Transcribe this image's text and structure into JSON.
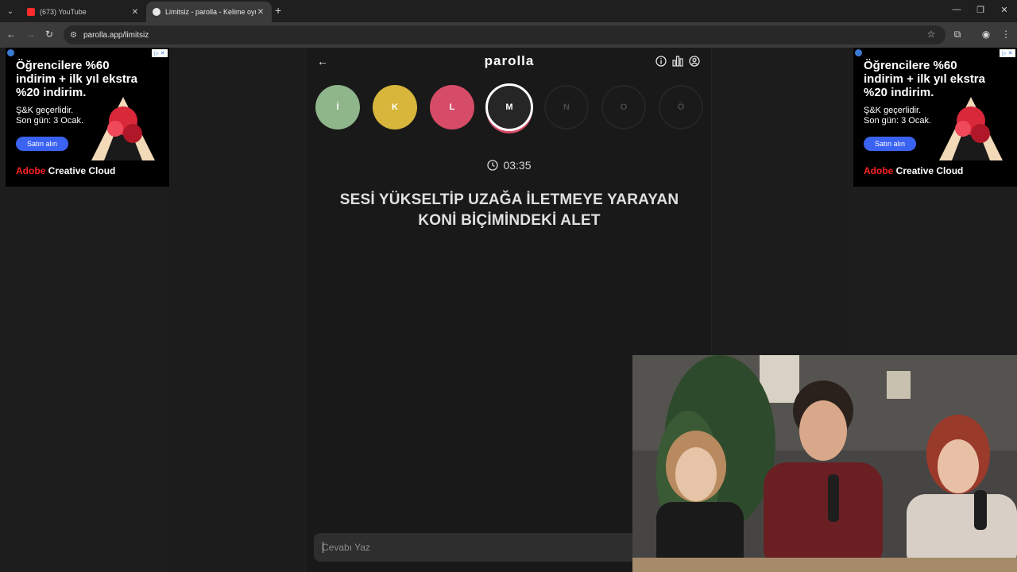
{
  "browser": {
    "tabs": [
      {
        "title": "(673) YouTube",
        "active": false
      },
      {
        "title": "Limitsiz - parolla - Kelime oyunu",
        "active": true
      }
    ],
    "url": "parolla.app/limitsiz"
  },
  "ad": {
    "headline": "Öğrencilere %60 indirim + ilk yıl ekstra %20 indirim.",
    "subline1": "Ş&K geçerlidir.",
    "subline2": "Son gün: 3 Ocak.",
    "cta": "Satın alın",
    "brand_prefix": "Adobe",
    "brand_name": " Creative Cloud"
  },
  "game": {
    "logo": "parolla",
    "letters": [
      {
        "char": "İ",
        "state": "correct",
        "color": "#8fb58a"
      },
      {
        "char": "K",
        "state": "passed",
        "color": "#d7b63b"
      },
      {
        "char": "L",
        "state": "wrong",
        "color": "#d64c68"
      },
      {
        "char": "M",
        "state": "current"
      },
      {
        "char": "N",
        "state": "pending"
      },
      {
        "char": "O",
        "state": "pending"
      },
      {
        "char": "Ö",
        "state": "pending"
      }
    ],
    "timer": "03:35",
    "question": "SESİ YÜKSELTİP UZAĞA İLETMEYE YARAYAN KONİ BİÇİMİNDEKİ ALET",
    "answer_placeholder": "Cevabı Yaz"
  }
}
